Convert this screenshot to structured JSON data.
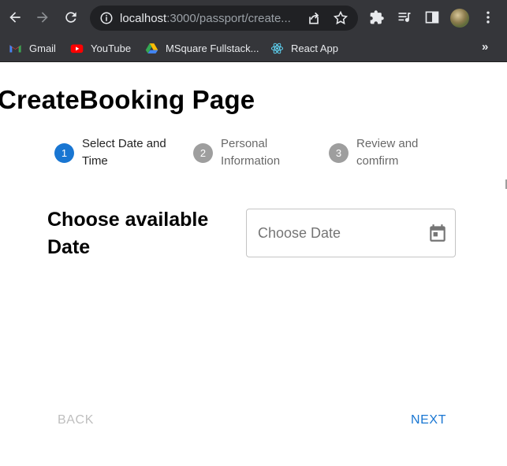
{
  "browser": {
    "url_host": "localhost",
    "url_rest": ":3000/passport/create...",
    "bookmarks": [
      {
        "label": "Gmail",
        "icon": "gmail-icon"
      },
      {
        "label": "YouTube",
        "icon": "youtube-icon"
      },
      {
        "label": "MSquare Fullstack...",
        "icon": "google-drive-icon"
      },
      {
        "label": "React App",
        "icon": "react-icon"
      }
    ],
    "bookmarks_overflow": "»"
  },
  "page": {
    "title": "CreateBooking Page"
  },
  "stepper": {
    "accent": "#1976d2",
    "steps": [
      {
        "number": "1",
        "label": "Select Date and Time",
        "state": "active"
      },
      {
        "number": "2",
        "label": "Personal Information",
        "state": "inactive"
      },
      {
        "number": "3",
        "label": "Review and comfirm",
        "state": "inactive"
      }
    ]
  },
  "form": {
    "heading": "Choose available Date",
    "date_placeholder": "Choose Date",
    "date_value": ""
  },
  "footer": {
    "back_label": "BACK",
    "next_label": "NEXT",
    "back_disabled": true
  }
}
